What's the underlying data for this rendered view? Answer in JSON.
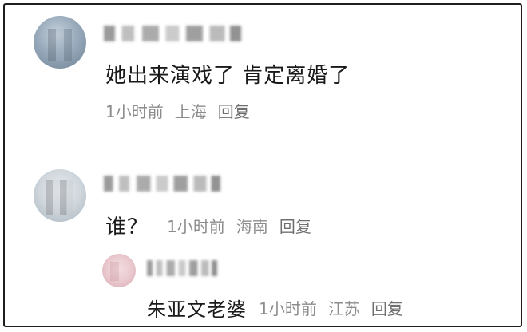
{
  "comments": [
    {
      "text": "她出来演戏了 肯定离婚了",
      "time": "1小时前",
      "location": "上海",
      "reply_label": "回复"
    },
    {
      "text": "谁？",
      "time": "1小时前",
      "location": "海南",
      "reply_label": "回复",
      "replies": [
        {
          "text": "朱亚文老婆",
          "time": "1小时前",
          "location": "江苏",
          "reply_label": "回复"
        }
      ]
    }
  ]
}
